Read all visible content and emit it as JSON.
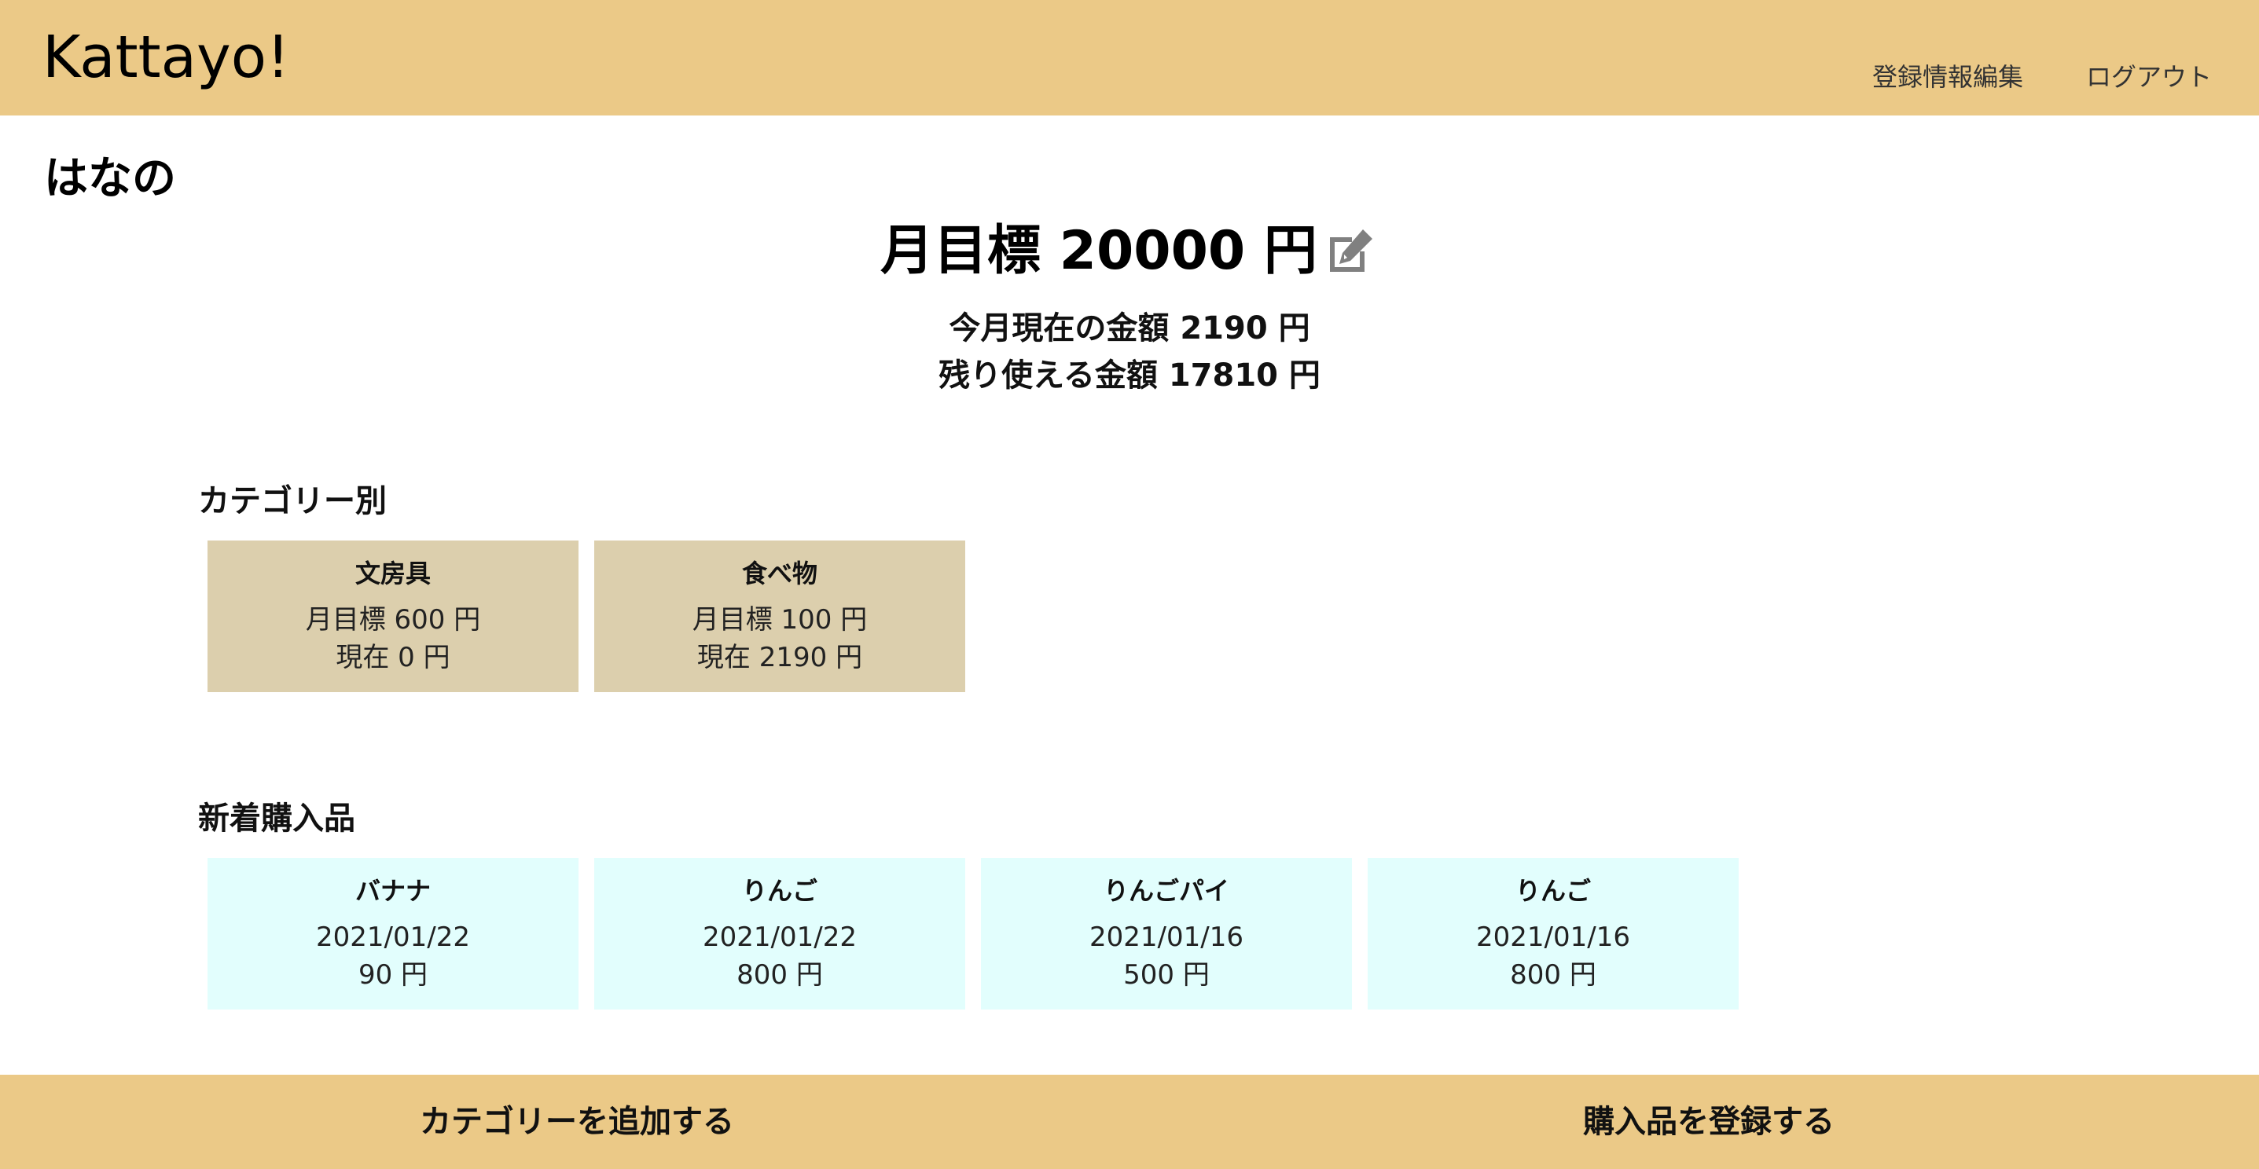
{
  "header": {
    "logo": "Kattayo!",
    "nav": {
      "edit_profile": "登録情報編集",
      "logout": "ログアウト"
    }
  },
  "user": {
    "name": "はなの"
  },
  "goal": {
    "label": "月目標 20000 円",
    "edit_icon": "edit-icon"
  },
  "summary": {
    "current": "今月現在の金額 2190 円",
    "remaining": "残り使える金額 17810 円"
  },
  "categories": {
    "heading": "カテゴリー別",
    "items": [
      {
        "name": "文房具",
        "goal": "月目標 600 円",
        "current": "現在 0 円"
      },
      {
        "name": "食べ物",
        "goal": "月目標 100 円",
        "current": "現在 2190 円"
      }
    ]
  },
  "recent": {
    "heading": "新着購入品",
    "items": [
      {
        "name": "バナナ",
        "date": "2021/01/22",
        "price": "90 円"
      },
      {
        "name": "りんご",
        "date": "2021/01/22",
        "price": "800 円"
      },
      {
        "name": "りんごパイ",
        "date": "2021/01/16",
        "price": "500 円"
      },
      {
        "name": "りんご",
        "date": "2021/01/16",
        "price": "800 円"
      }
    ]
  },
  "footer": {
    "add_category": "カテゴリーを追加する",
    "register_purchase": "購入品を登録する"
  },
  "colors": {
    "header_bg": "#EBC987",
    "category_card_bg": "#DCCFAD",
    "purchase_card_bg": "#E2FEFD",
    "icon_gray": "#808080"
  }
}
